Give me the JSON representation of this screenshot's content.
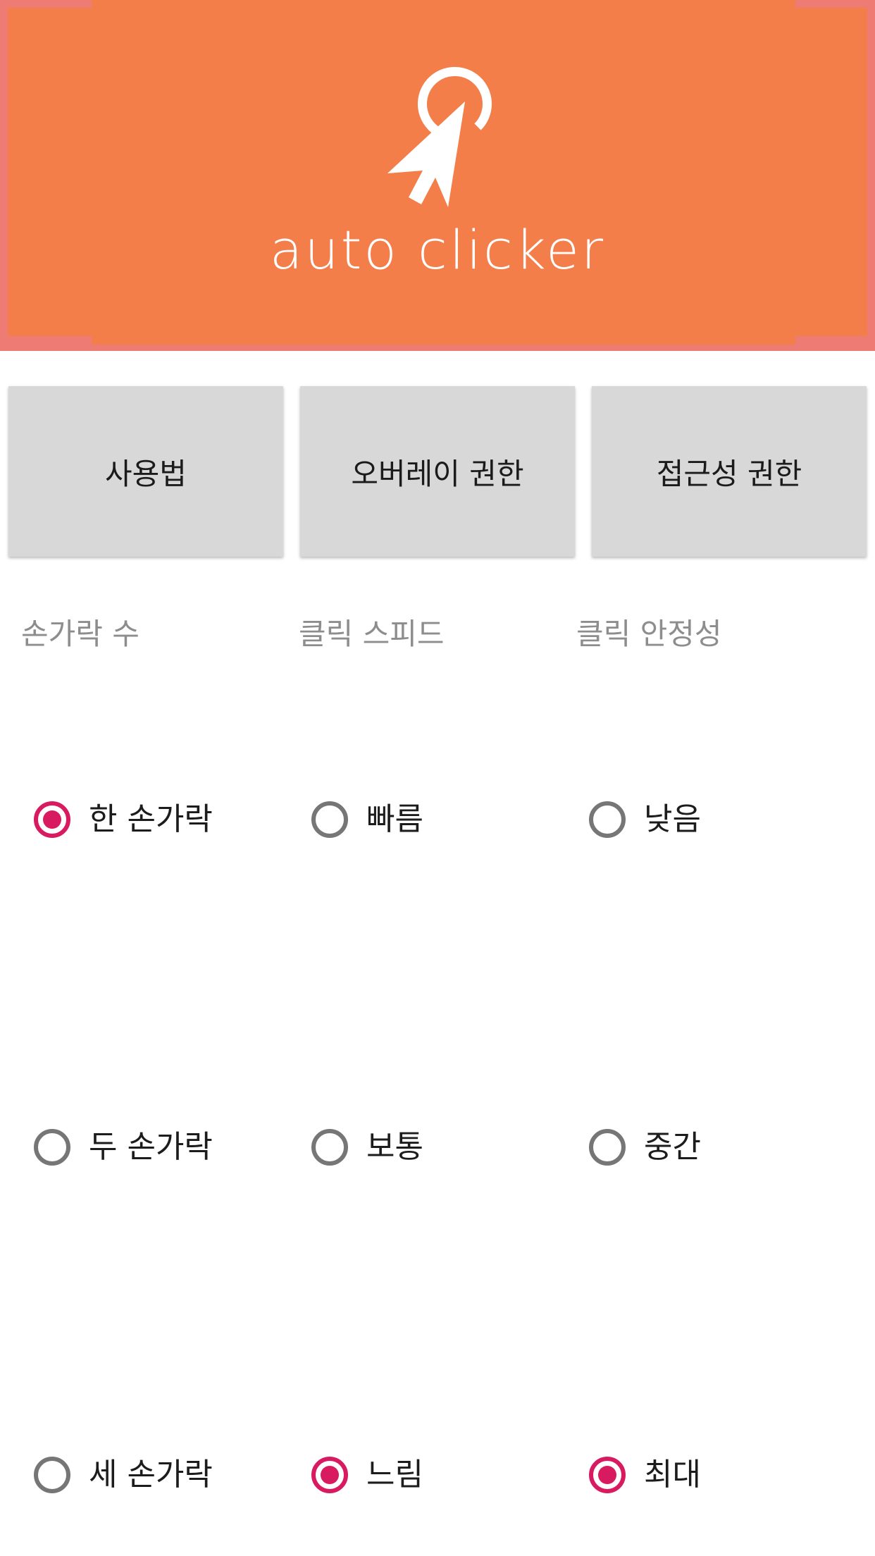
{
  "header": {
    "logo_text": "auto clicker",
    "logo_icon": "cursor-click-icon",
    "colors": {
      "banner": "#f37e4a",
      "banner_edge": "#ee7b74"
    }
  },
  "buttons": {
    "usage": "사용법",
    "overlay_permission": "오버레이 권한",
    "accessibility_permission": "접근성 권한"
  },
  "columns": {
    "fingers": {
      "header": "손가락 수",
      "options": [
        "한 손가락",
        "두 손가락",
        "세 손가락"
      ],
      "selected": "한 손가락"
    },
    "speed": {
      "header": "클릭 스피드",
      "options": [
        "빠름",
        "보통",
        "느림"
      ],
      "selected": "느림"
    },
    "stability": {
      "header": "클릭 안정성",
      "options": [
        "낮음",
        "중간",
        "최대"
      ],
      "selected": "최대"
    }
  },
  "accent_color": "#d81b60"
}
